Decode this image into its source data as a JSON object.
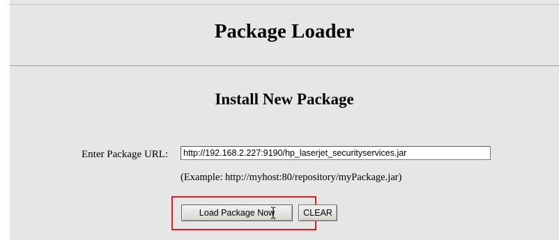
{
  "header": {
    "title": "Package Loader"
  },
  "section": {
    "title": "Install New Package"
  },
  "form": {
    "url_label": "Enter Package URL:",
    "url_value": "http://192.168.2.227:9190/hp_laserjet_securityservices.jar",
    "example": "(Example: http://myhost:80/repository/myPackage.jar)",
    "load_button_label": "Load Package Now",
    "clear_button_label": "CLEAR"
  },
  "annotation": {
    "highlight_color": "#e11b1b"
  },
  "colors": {
    "panel_background": "#e6e6e6"
  },
  "icons": {
    "cursor": "text-cursor-icon"
  }
}
